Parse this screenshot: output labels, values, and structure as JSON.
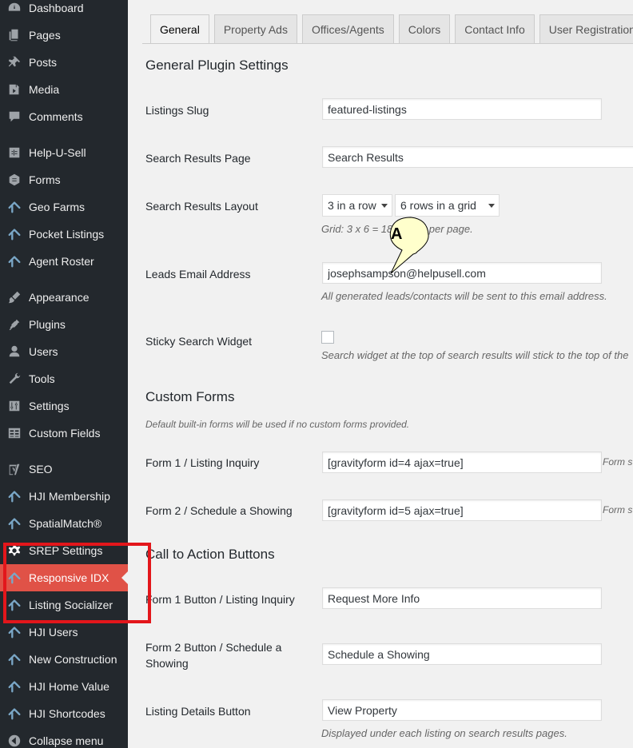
{
  "sidebar": {
    "items": [
      {
        "label": "Dashboard",
        "icon": "dashboard-icon"
      },
      {
        "label": "Pages",
        "icon": "pages-icon"
      },
      {
        "label": "Posts",
        "icon": "pin-icon"
      },
      {
        "label": "Media",
        "icon": "media-icon"
      },
      {
        "label": "Comments",
        "icon": "comments-icon"
      },
      {
        "label": "Help-U-Sell",
        "icon": "plugin-grid-icon"
      },
      {
        "label": "Forms",
        "icon": "forms-icon"
      },
      {
        "label": "Geo Farms",
        "icon": "house-icon"
      },
      {
        "label": "Pocket Listings",
        "icon": "house-icon"
      },
      {
        "label": "Agent Roster",
        "icon": "house-icon"
      },
      {
        "label": "Appearance",
        "icon": "brush-icon"
      },
      {
        "label": "Plugins",
        "icon": "plugin-icon"
      },
      {
        "label": "Users",
        "icon": "user-icon"
      },
      {
        "label": "Tools",
        "icon": "wrench-icon"
      },
      {
        "label": "Settings",
        "icon": "settings-icon"
      },
      {
        "label": "Custom Fields",
        "icon": "table-icon"
      },
      {
        "label": "SEO",
        "icon": "seo-icon"
      },
      {
        "label": "HJI Membership",
        "icon": "house-icon"
      },
      {
        "label": "SpatialMatch®",
        "icon": "house-icon"
      },
      {
        "label": "SREP Settings",
        "icon": "gear-icon"
      },
      {
        "label": "Responsive IDX",
        "icon": "house-icon"
      },
      {
        "label": "Listing Socializer",
        "icon": "house-icon"
      },
      {
        "label": "HJI Users",
        "icon": "house-icon"
      },
      {
        "label": "New Construction",
        "icon": "house-icon"
      },
      {
        "label": "HJI Home Value",
        "icon": "house-icon"
      },
      {
        "label": "HJI Shortcodes",
        "icon": "house-icon"
      },
      {
        "label": "Collapse menu",
        "icon": "collapse-icon"
      }
    ],
    "active_item": "Responsive IDX"
  },
  "tabs": [
    "General",
    "Property Ads",
    "Offices/Agents",
    "Colors",
    "Contact Info",
    "User Registration"
  ],
  "active_tab": "General",
  "sections": {
    "general": "General Plugin Settings",
    "custom_forms": "Custom Forms",
    "cta": "Call to Action Buttons"
  },
  "fields": {
    "listings_slug": {
      "label": "Listings Slug",
      "value": "featured-listings"
    },
    "search_results_page": {
      "label": "Search Results Page",
      "value": "Search Results"
    },
    "search_results_layout": {
      "label": "Search Results Layout",
      "per_row": "3 in a row",
      "rows": "6 rows in a grid",
      "desc": "Grid: 3 x 6 = 18 results per page."
    },
    "leads_email": {
      "label": "Leads Email Address",
      "value": "josephsampson@helpusell.com",
      "desc": "All generated leads/contacts will be sent to this email address."
    },
    "sticky_widget": {
      "label": "Sticky Search Widget",
      "checked": false,
      "desc": "Search widget at the top of search results will stick to the top of the"
    },
    "custom_forms_desc": "Default built-in forms will be used if no custom forms provided.",
    "form1": {
      "label": "Form 1 / Listing Inquiry",
      "value": "[gravityform id=4 ajax=true]",
      "note": "Form s"
    },
    "form2": {
      "label": "Form 2 / Schedule a Showing",
      "value": "[gravityform id=5 ajax=true]",
      "note": "Form s"
    },
    "form1_button": {
      "label": "Form 1 Button / Listing Inquiry",
      "value": "Request More Info"
    },
    "form2_button": {
      "label_line1": "Form 2 Button / Schedule a",
      "label_line2": "Showing",
      "value": "Schedule a Showing"
    },
    "details_button": {
      "label": "Listing Details Button",
      "value": "View Property",
      "desc": "Displayed under each listing on search results pages."
    }
  },
  "callout": {
    "text": "A"
  },
  "colors": {
    "sidebar_bg": "#23282d",
    "active_item_bg": "#e05247",
    "highlight_box": "#e3161b",
    "callout_fill": "#ffffcc"
  }
}
